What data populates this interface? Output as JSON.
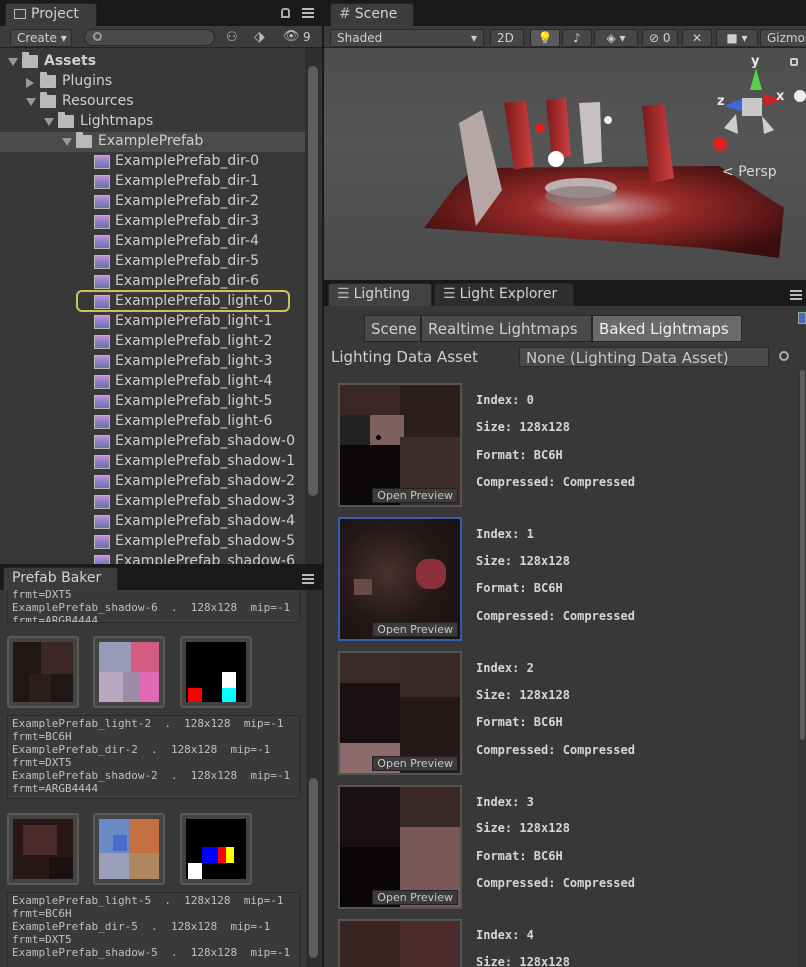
{
  "project": {
    "tab_label": "Project",
    "create_label": "Create",
    "search_placeholder": "",
    "hidden_count": "9",
    "tree": [
      {
        "label": "Assets",
        "kind": "folder",
        "depth": 0,
        "expanded": true,
        "bold": true
      },
      {
        "label": "Plugins",
        "kind": "folder",
        "depth": 1,
        "expanded": false
      },
      {
        "label": "Resources",
        "kind": "folder",
        "depth": 1,
        "expanded": true
      },
      {
        "label": "Lightmaps",
        "kind": "folder",
        "depth": 2,
        "expanded": true
      },
      {
        "label": "ExamplePrefab",
        "kind": "folder",
        "depth": 3,
        "expanded": true,
        "selected": true
      },
      {
        "label": "ExamplePrefab_dir-0",
        "kind": "texture",
        "depth": 4
      },
      {
        "label": "ExamplePrefab_dir-1",
        "kind": "texture",
        "depth": 4
      },
      {
        "label": "ExamplePrefab_dir-2",
        "kind": "texture",
        "depth": 4
      },
      {
        "label": "ExamplePrefab_dir-3",
        "kind": "texture",
        "depth": 4
      },
      {
        "label": "ExamplePrefab_dir-4",
        "kind": "texture",
        "depth": 4
      },
      {
        "label": "ExamplePrefab_dir-5",
        "kind": "texture",
        "depth": 4
      },
      {
        "label": "ExamplePrefab_dir-6",
        "kind": "texture",
        "depth": 4
      },
      {
        "label": "ExamplePrefab_light-0",
        "kind": "texture",
        "depth": 4,
        "highlighted": true
      },
      {
        "label": "ExamplePrefab_light-1",
        "kind": "texture",
        "depth": 4
      },
      {
        "label": "ExamplePrefab_light-2",
        "kind": "texture",
        "depth": 4
      },
      {
        "label": "ExamplePrefab_light-3",
        "kind": "texture",
        "depth": 4
      },
      {
        "label": "ExamplePrefab_light-4",
        "kind": "texture",
        "depth": 4
      },
      {
        "label": "ExamplePrefab_light-5",
        "kind": "texture",
        "depth": 4
      },
      {
        "label": "ExamplePrefab_light-6",
        "kind": "texture",
        "depth": 4
      },
      {
        "label": "ExamplePrefab_shadow-0",
        "kind": "texture",
        "depth": 4
      },
      {
        "label": "ExamplePrefab_shadow-1",
        "kind": "texture",
        "depth": 4
      },
      {
        "label": "ExamplePrefab_shadow-2",
        "kind": "texture",
        "depth": 4
      },
      {
        "label": "ExamplePrefab_shadow-3",
        "kind": "texture",
        "depth": 4
      },
      {
        "label": "ExamplePrefab_shadow-4",
        "kind": "texture",
        "depth": 4
      },
      {
        "label": "ExamplePrefab_shadow-5",
        "kind": "texture",
        "depth": 4
      },
      {
        "label": "ExamplePrefab_shadow-6",
        "kind": "texture",
        "depth": 4
      }
    ]
  },
  "scene": {
    "tab_label": "Scene",
    "shading_mode": "Shaded",
    "mode_2d": "2D",
    "hidden_count": "0",
    "gizmos_label": "Gizmos",
    "persp_label": "Persp",
    "axis_y": "y",
    "axis_x": "x",
    "axis_z": "z"
  },
  "lighting": {
    "tab_label": "Lighting",
    "tab2_label": "Light Explorer",
    "segments": [
      "Scene",
      "Realtime Lightmaps",
      "Baked Lightmaps"
    ],
    "active_segment": 2,
    "data_asset_label": "Lighting Data Asset",
    "data_asset_value": "None (Lighting Data Asset)",
    "open_preview_label": "Open Preview",
    "lightmaps": [
      {
        "index": "Index: 0",
        "size": "Size: 128x128",
        "format": "Format: BC6H",
        "compressed": "Compressed: Compressed"
      },
      {
        "index": "Index: 1",
        "size": "Size: 128x128",
        "format": "Format: BC6H",
        "compressed": "Compressed: Compressed"
      },
      {
        "index": "Index: 2",
        "size": "Size: 128x128",
        "format": "Format: BC6H",
        "compressed": "Compressed: Compressed"
      },
      {
        "index": "Index: 3",
        "size": "Size: 128x128",
        "format": "Format: BC6H",
        "compressed": "Compressed: Compressed"
      },
      {
        "index": "Index: 4",
        "size": "Size: 128x128",
        "format": "",
        "compressed": ""
      }
    ]
  },
  "prefab_baker": {
    "tab_label": "Prefab Baker",
    "text_top": "frmt=DXT5\nExamplePrefab_shadow-6  .  128x128  mip=-1\nfrmt=ARGB4444",
    "text_mid": "ExamplePrefab_light-2  .  128x128  mip=-1\nfrmt=BC6H\nExamplePrefab_dir-2  .  128x128  mip=-1\nfrmt=DXT5\nExamplePrefab_shadow-2  .  128x128  mip=-1\nfrmt=ARGB4444",
    "text_bottom": "ExamplePrefab_light-5  .  128x128  mip=-1\nfrmt=BC6H\nExamplePrefab_dir-5  .  128x128  mip=-1\nfrmt=DXT5\nExamplePrefab_shadow-5  .  128x128  mip=-1"
  },
  "colors": {
    "accent_selection": "#3c58b0",
    "highlight_ring": "#c9c45a"
  }
}
